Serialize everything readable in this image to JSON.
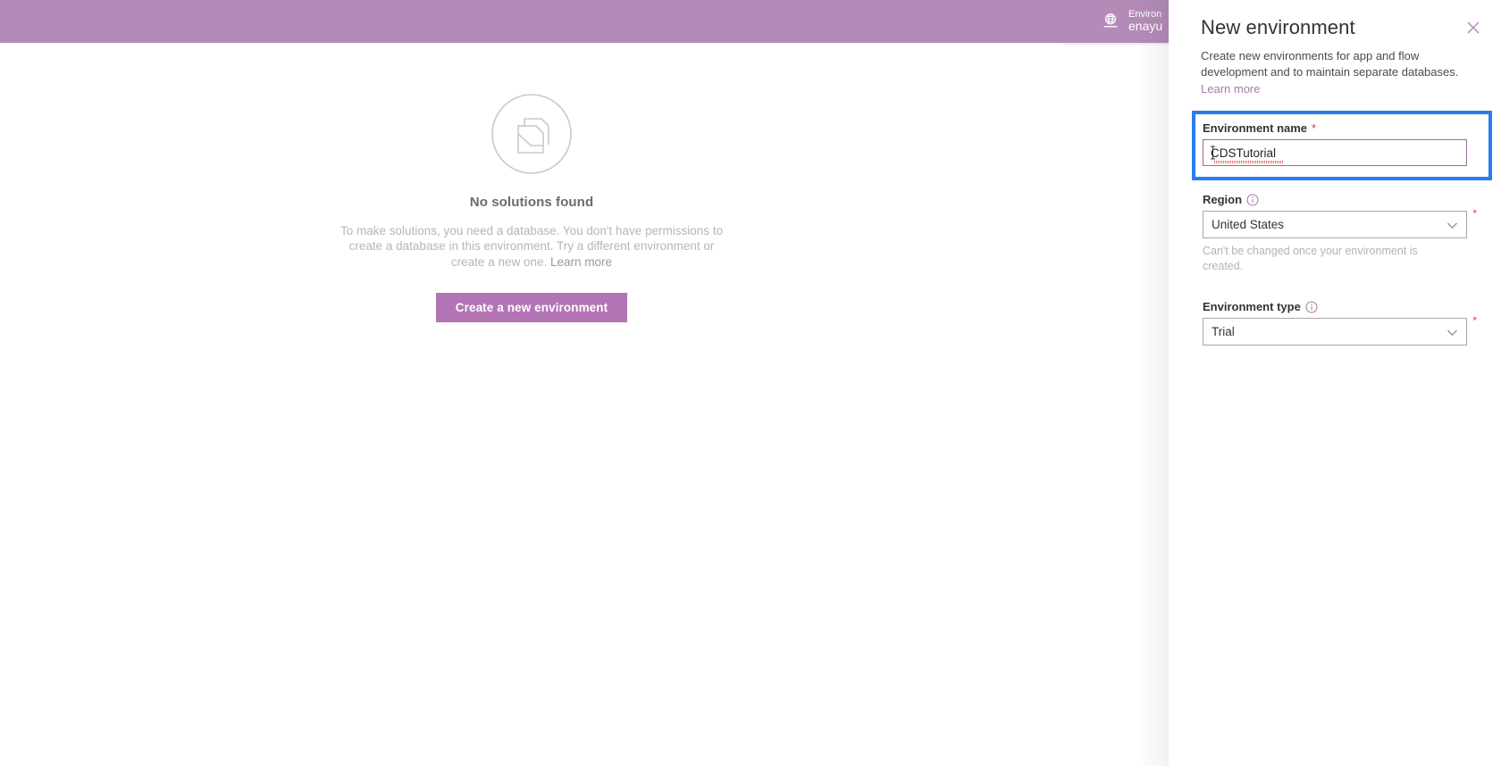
{
  "topbar": {
    "background": "#b48bb8",
    "env_picker": {
      "icon": "globe-environment-icon",
      "label": "Environ",
      "value": "enayu"
    }
  },
  "main": {
    "empty_state": {
      "icon": "no-solutions-document-icon",
      "title": "No solutions found",
      "description_part1": "To make solutions, you need a database. You don't have permissions to create a database in this environment. Try a different environment or create a new one.",
      "description_link": "Learn more",
      "button_label": "Create a new environment",
      "button_color": "#b274b4"
    }
  },
  "panel": {
    "title": "New environment",
    "close_icon": "close-icon",
    "description_part1": "Create new environments for app and flow development and to maintain separate databases.",
    "description_link": "Learn more",
    "focus_highlight_color": "#2b7cf0",
    "fields": {
      "environment_name": {
        "label": "Environment name",
        "required_marker": "*",
        "value": "CDSTutorial",
        "placeholder": ""
      },
      "region": {
        "label": "Region",
        "info_icon": "info-icon",
        "required_marker": "*",
        "value": "United States",
        "chevron_icon": "chevron-down-icon",
        "hint": "Can't be changed once your environment is created."
      },
      "environment_type": {
        "label": "Environment type",
        "info_icon": "info-icon",
        "required_marker": "*",
        "value": "Trial",
        "chevron_icon": "chevron-down-icon"
      }
    }
  }
}
